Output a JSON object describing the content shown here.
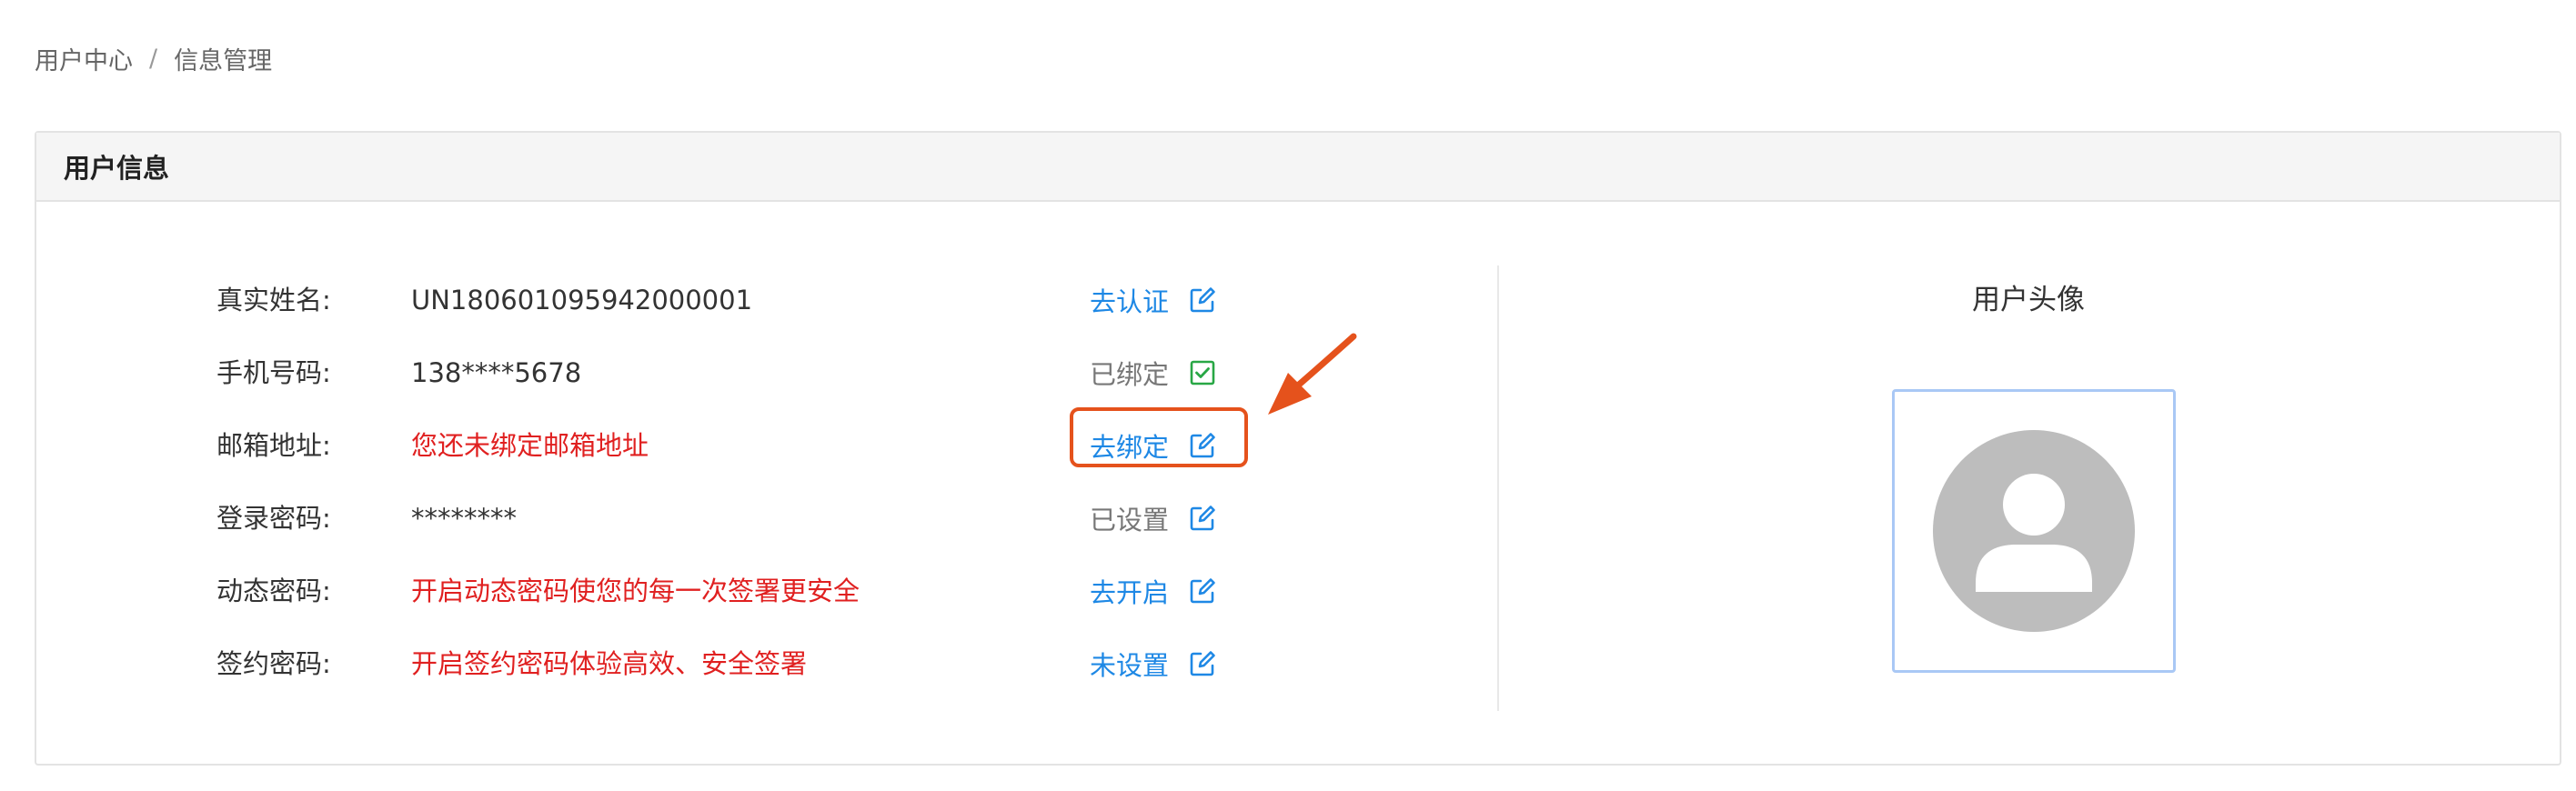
{
  "breadcrumb": {
    "items": [
      "用户中心",
      "信息管理"
    ],
    "separator": "/"
  },
  "card": {
    "title": "用户信息"
  },
  "rows": [
    {
      "label": "真实姓名:",
      "value": "UN180601095942000001",
      "value_type": "normal",
      "action_text": "去认证",
      "action_state": "link",
      "icon": "edit-icon"
    },
    {
      "label": "手机号码:",
      "value": "138****5678",
      "value_type": "normal",
      "action_text": "已绑定",
      "action_state": "done",
      "icon": "checkbox-checked-icon"
    },
    {
      "label": "邮箱地址:",
      "value": "您还未绑定邮箱地址",
      "value_type": "warn",
      "action_text": "去绑定",
      "action_state": "link",
      "icon": "edit-icon"
    },
    {
      "label": "登录密码:",
      "value": "********",
      "value_type": "normal",
      "action_text": "已设置",
      "action_state": "done",
      "icon": "edit-icon"
    },
    {
      "label": "动态密码:",
      "value": "开启动态密码使您的每一次签署更安全",
      "value_type": "warn",
      "action_text": "去开启",
      "action_state": "link",
      "icon": "edit-icon"
    },
    {
      "label": "签约密码:",
      "value": "开启签约密码体验高效、安全签署",
      "value_type": "warn",
      "action_text": "未设置",
      "action_state": "link",
      "icon": "edit-icon"
    }
  ],
  "avatar": {
    "title": "用户头像",
    "icon": "default-avatar-icon"
  },
  "annotation": {
    "highlight_target": "去绑定",
    "color": "#e5521c"
  },
  "colors": {
    "link": "#1e88e5",
    "warn": "#e02020",
    "success": "#28a745",
    "avatar_gray": "#bdbdbd",
    "annotation": "#e5521c"
  }
}
